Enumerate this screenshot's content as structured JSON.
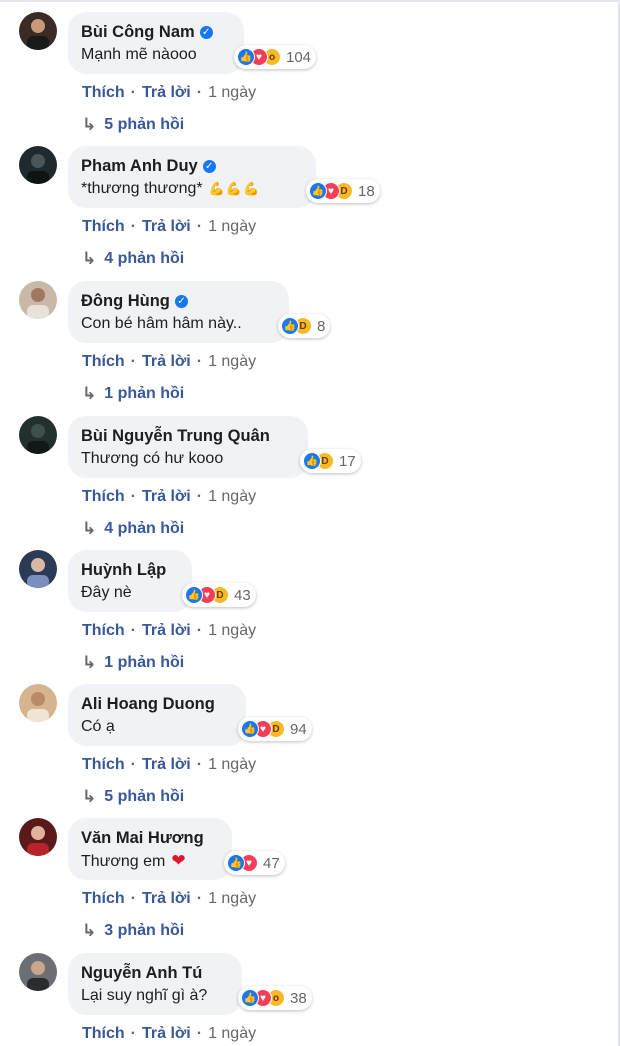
{
  "actions": {
    "like": "Thích",
    "reply": "Trả lời",
    "time": "1 ngày"
  },
  "comments": [
    {
      "name": "Bùi Công Nam",
      "verified": true,
      "text": "Mạnh mẽ nàooo",
      "reactions": [
        "like",
        "love",
        "wow"
      ],
      "count": "104",
      "replies": "5 phản hồi",
      "avatar_color": "#3a2c24"
    },
    {
      "name": "Pham Anh Duy",
      "verified": true,
      "text": "*thương thương*",
      "text_extra": "💪💪💪",
      "reactions": [
        "like",
        "love",
        "haha"
      ],
      "count": "18",
      "replies": "4 phản hồi",
      "avatar_color": "#1f2a2c"
    },
    {
      "name": "Đông Hùng",
      "verified": true,
      "text": "Con bé hâm hâm này..",
      "reactions": [
        "like",
        "haha"
      ],
      "count": "8",
      "replies": "1 phản hồi",
      "avatar_color": "#c8b8a8"
    },
    {
      "name": "Bùi Nguyễn Trung Quân",
      "verified": false,
      "text": "Thương có hư kooo",
      "reactions": [
        "like",
        "haha"
      ],
      "count": "17",
      "replies": "4 phản hồi",
      "avatar_color": "#223030"
    },
    {
      "name": "Huỳnh Lập",
      "verified": false,
      "text": "Đây nè",
      "reactions": [
        "like",
        "love",
        "haha"
      ],
      "count": "43",
      "replies": "1 phản hồi",
      "avatar_color": "#2c3a55"
    },
    {
      "name": "Ali Hoang Duong",
      "verified": false,
      "text": "Có ạ",
      "reactions": [
        "like",
        "love",
        "haha"
      ],
      "count": "94",
      "replies": "5 phản hồi",
      "avatar_color": "#d6b48e"
    },
    {
      "name": "Văn Mai Hương",
      "verified": false,
      "text": "Thương em",
      "text_extra": "❤",
      "reactions": [
        "like",
        "love"
      ],
      "count": "47",
      "replies": "3 phản hồi",
      "avatar_color": "#5a1a1a"
    },
    {
      "name": "Nguyễn Anh Tú",
      "verified": false,
      "text": "Lại suy nghĩ gì à?",
      "reactions": [
        "like",
        "love",
        "wow"
      ],
      "count": "38",
      "replies": "",
      "avatar_color": "#6b6e75"
    }
  ]
}
